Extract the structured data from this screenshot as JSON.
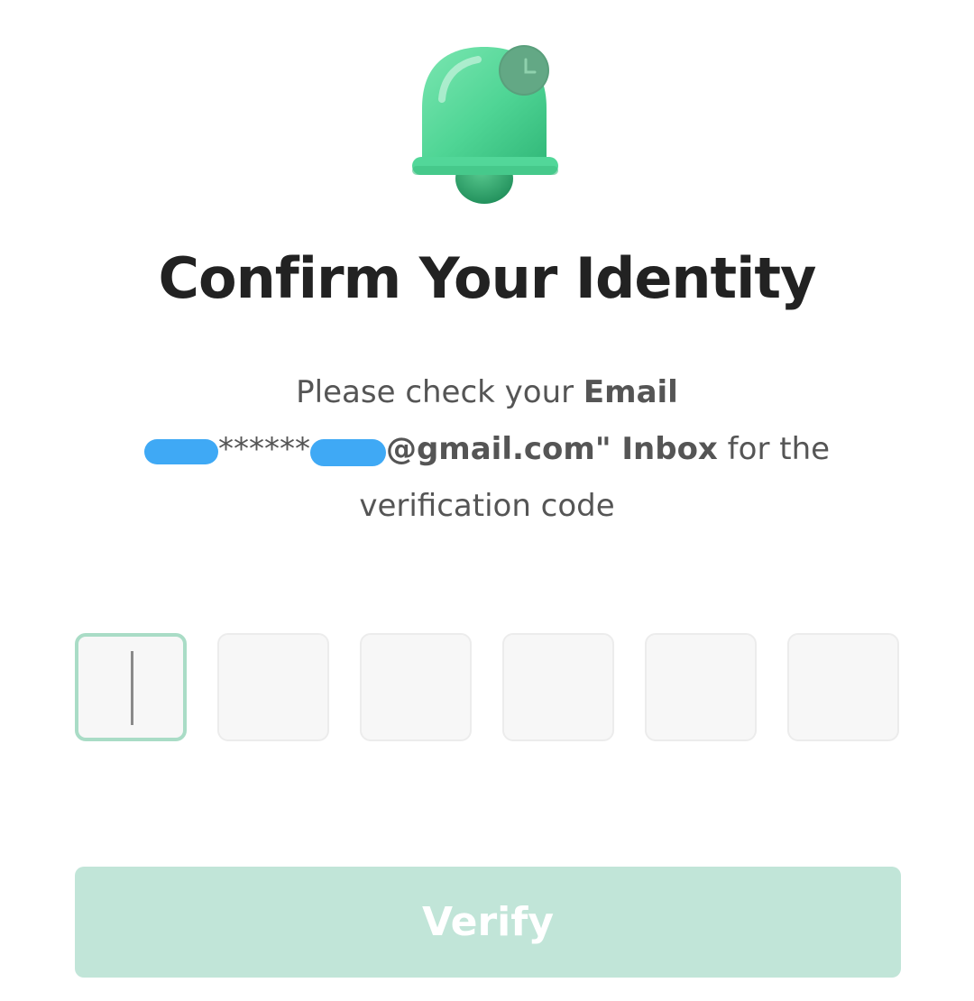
{
  "header": {
    "icon": "bell-notification-icon",
    "title": "Confirm Your Identity"
  },
  "description": {
    "prefix": "Please check your ",
    "email_label": "Email",
    "masked_email": "******",
    "email_suffix": "@gmail.com\" Inbox",
    "after_email": " for the",
    "line3": "verification code"
  },
  "otp": {
    "length": 6,
    "values": [
      "",
      "",
      "",
      "",
      "",
      ""
    ],
    "active_index": 0
  },
  "actions": {
    "verify_label": "Verify"
  },
  "colors": {
    "accent": "#5fd29a",
    "button_disabled": "#c1e5d8",
    "input_focus_border": "#a9dcc6",
    "redaction": "#3fa9f5"
  }
}
